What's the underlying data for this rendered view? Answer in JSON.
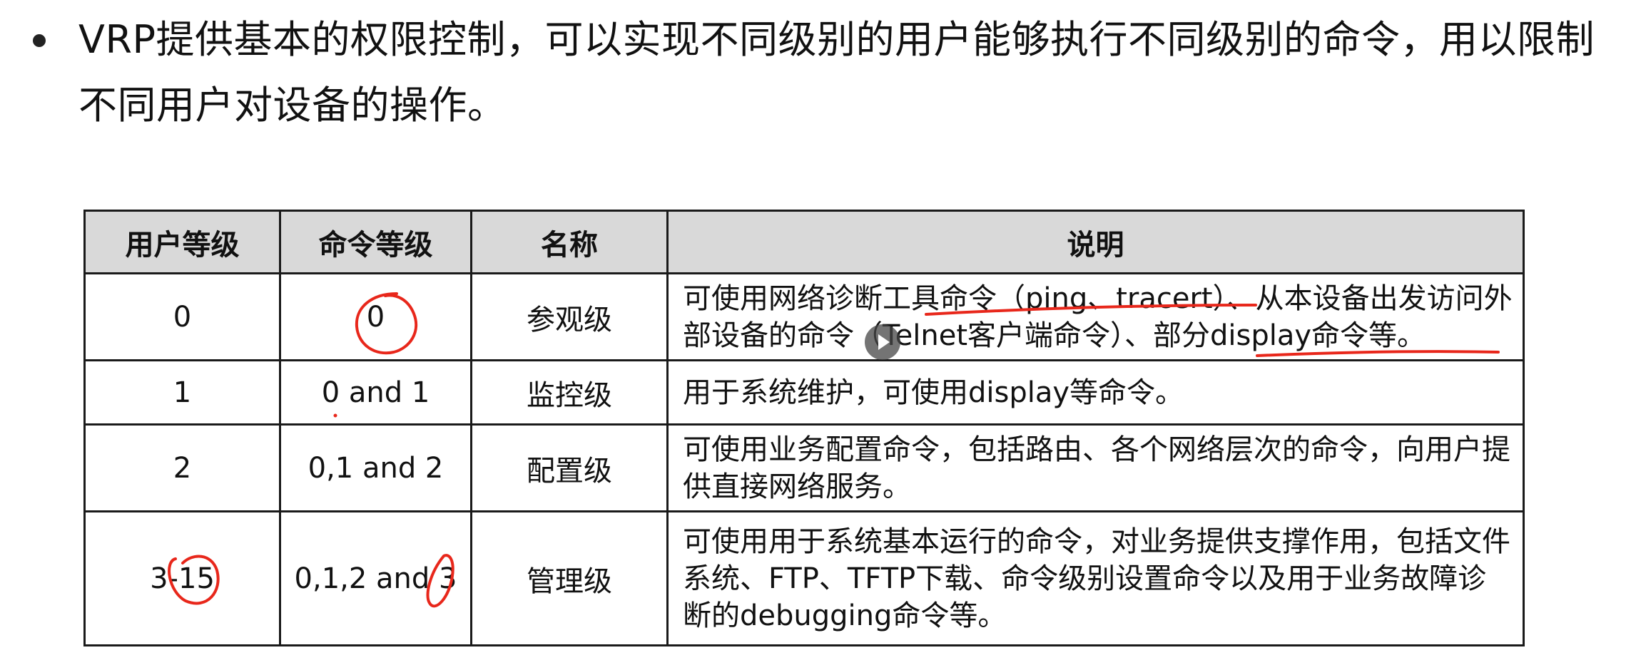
{
  "intro": {
    "text": "VRP提供基本的权限控制，可以实现不同级别的用户能够执行不同级别的命令，用以限制不同用户对设备的操作。"
  },
  "table": {
    "headers": [
      "用户等级",
      "命令等级",
      "名称",
      "说明"
    ],
    "rows": [
      {
        "user_level": "0",
        "command_level": "0",
        "name": "参观级",
        "desc": "可使用网络诊断工具命令（ping、tracert）、从本设备出发访问外部设备的命令（Telnet客户端命令）、部分display命令等。"
      },
      {
        "user_level": "1",
        "command_level": "0 and 1",
        "name": "监控级",
        "desc": "用于系统维护，可使用display等命令。"
      },
      {
        "user_level": "2",
        "command_level": "0,1 and 2",
        "name": "配置级",
        "desc": "可使用业务配置命令，包括路由、各个网络层次的命令，向用户提供直接网络服务。"
      },
      {
        "user_level": "3-15",
        "command_level": "0,1,2 and 3",
        "name": "管理级",
        "desc": "可使用用于系统基本运行的命令，对业务提供支撑作用，包括文件系统、FTP、TFTP下载、命令级别设置命令以及用于业务故障诊断的debugging命令等。"
      }
    ]
  },
  "colors": {
    "header_bg": "#d9d9d9",
    "border": "#1a1a1a",
    "annotation": "#e8271b"
  },
  "overlay": {
    "icon": "play-icon"
  }
}
